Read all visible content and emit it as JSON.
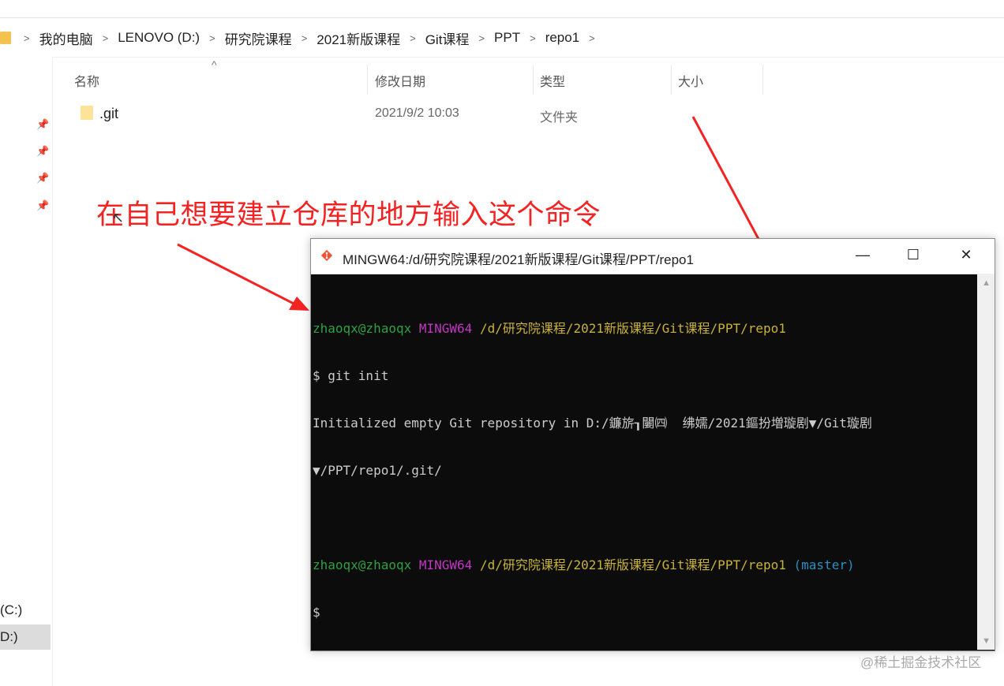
{
  "breadcrumb": {
    "items": [
      "我的电脑",
      "LENOVO (D:)",
      "研究院课程",
      "2021新版课程",
      "Git课程",
      "PPT",
      "repo1"
    ],
    "separator": ">"
  },
  "columns": {
    "name": "名称",
    "modified": "修改日期",
    "type": "类型",
    "size": "大小"
  },
  "files": [
    {
      "name": ".git",
      "modified": "2021/9/2 10:03",
      "type": "文件夹",
      "size": ""
    }
  ],
  "navpane": {
    "drives": [
      "(C:)",
      "D:)"
    ]
  },
  "annotation": "在自己想要建立仓库的地方输入这个命令",
  "terminal": {
    "title": "MINGW64:/d/研究院课程/2021新版课程/Git课程/PPT/repo1",
    "controls": {
      "minimize": "—",
      "maximize": "☐",
      "close": "✕"
    },
    "prompt1": {
      "user": "zhaoqx@zhaoqx",
      "env": "MINGW64",
      "path": "/d/研究院课程/2021新版课程/Git课程/PPT/repo1"
    },
    "command": "$ git init",
    "output1": "Initialized empty Git repository in D:/鐮旂┒闄㈣  绋嬬/2021鏂扮増璇剧▼/Git璇剧",
    "output2": "▼/PPT/repo1/.git/",
    "prompt2": {
      "user": "zhaoqx@zhaoqx",
      "env": "MINGW64",
      "path": "/d/研究院课程/2021新版课程/Git课程/PPT/repo1",
      "branch": "(master)"
    },
    "cursor_line": "$"
  },
  "watermark": "@稀土掘金技术社区",
  "colors": {
    "annotation": "#f42222",
    "term_bg": "#0c0c0c",
    "term_green": "#2ea043",
    "term_magenta": "#c236c2",
    "term_yellow": "#c9b23b",
    "term_cyan": "#2b8fc4"
  }
}
